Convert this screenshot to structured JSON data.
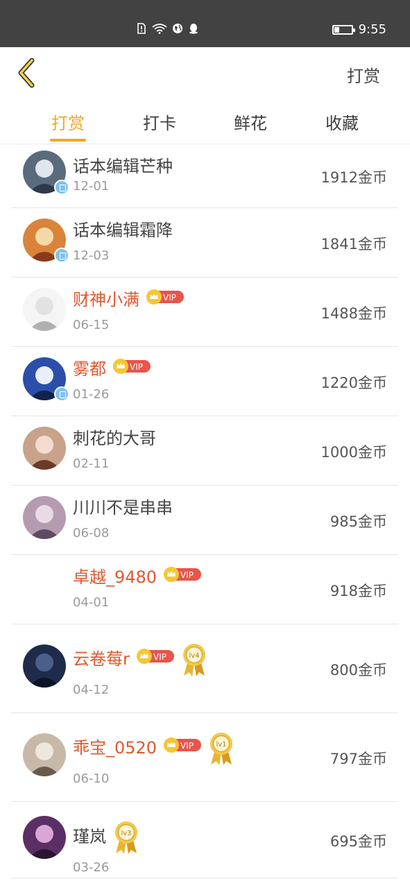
{
  "status_bar": {
    "time": "9:55",
    "battery_level": 0.3
  },
  "header": {
    "back_icon": "chevron-left-icon",
    "title": "打赏"
  },
  "tabs": [
    {
      "label": "打赏",
      "active": true
    },
    {
      "label": "打卡",
      "active": false
    },
    {
      "label": "鲜花",
      "active": false
    },
    {
      "label": "收藏",
      "active": false
    }
  ],
  "colors": {
    "accent": "#f5a623",
    "vip_name": "#e0582f",
    "vip_badge": "#e8554a",
    "auth_badge": "#7ec3ec"
  },
  "list": [
    {
      "name": "话本编辑芒种",
      "date": "12-01",
      "amount": "1912金币",
      "vip": false,
      "level": "",
      "author_badge": true,
      "avatar": true
    },
    {
      "name": "话本编辑霜降",
      "date": "12-03",
      "amount": "1841金币",
      "vip": false,
      "level": "",
      "author_badge": true,
      "avatar": true
    },
    {
      "name": "财神小满",
      "date": "06-15",
      "amount": "1488金币",
      "vip": true,
      "level": "",
      "author_badge": false,
      "avatar": true
    },
    {
      "name": "雾都",
      "date": "01-26",
      "amount": "1220金币",
      "vip": true,
      "level": "",
      "author_badge": true,
      "avatar": true
    },
    {
      "name": "刺花的大哥",
      "date": "02-11",
      "amount": "1000金币",
      "vip": false,
      "level": "",
      "author_badge": false,
      "avatar": true
    },
    {
      "name": "川川不是串串",
      "date": "06-08",
      "amount": "985金币",
      "vip": false,
      "level": "",
      "author_badge": false,
      "avatar": true
    },
    {
      "name": "卓越_9480",
      "date": "04-01",
      "amount": "918金币",
      "vip": true,
      "level": "",
      "author_badge": false,
      "avatar": false
    },
    {
      "name": "云卷莓r",
      "date": "04-12",
      "amount": "800金币",
      "vip": true,
      "level": "lv4",
      "author_badge": false,
      "avatar": true
    },
    {
      "name": "乖宝_0520",
      "date": "06-10",
      "amount": "797金币",
      "vip": true,
      "level": "lv1",
      "author_badge": false,
      "avatar": true
    },
    {
      "name": "瑾岚",
      "date": "03-26",
      "amount": "695金币",
      "vip": false,
      "level": "lv3",
      "author_badge": false,
      "avatar": true
    }
  ],
  "vip_label": "VIP"
}
